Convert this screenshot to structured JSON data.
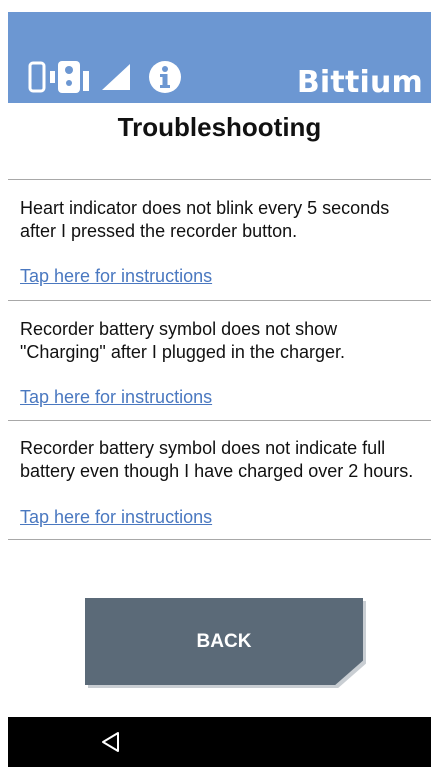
{
  "header": {
    "brand": "Bittium",
    "icons": [
      "phone-icon",
      "recorder-icon",
      "signal-icon",
      "info-icon"
    ],
    "bg_color": "#6c97d2"
  },
  "page": {
    "title": "Troubleshooting"
  },
  "items": [
    {
      "text": "Heart indicator does not blink every 5 seconds after I pressed the recorder button.",
      "link": "Tap here for instructions"
    },
    {
      "text": "Recorder battery symbol does not show \"Charging\" after I plugged in the charger.",
      "link": "Tap here for instructions"
    },
    {
      "text": "Recorder battery symbol does not indicate full battery even though I have charged over 2 hours.",
      "link": "Tap here for instructions"
    }
  ],
  "footer": {
    "back_label": "BACK"
  },
  "navbar": {
    "icons": [
      "back-triangle-icon"
    ]
  },
  "colors": {
    "link": "#4a78c0",
    "button": "#5b6a78"
  }
}
